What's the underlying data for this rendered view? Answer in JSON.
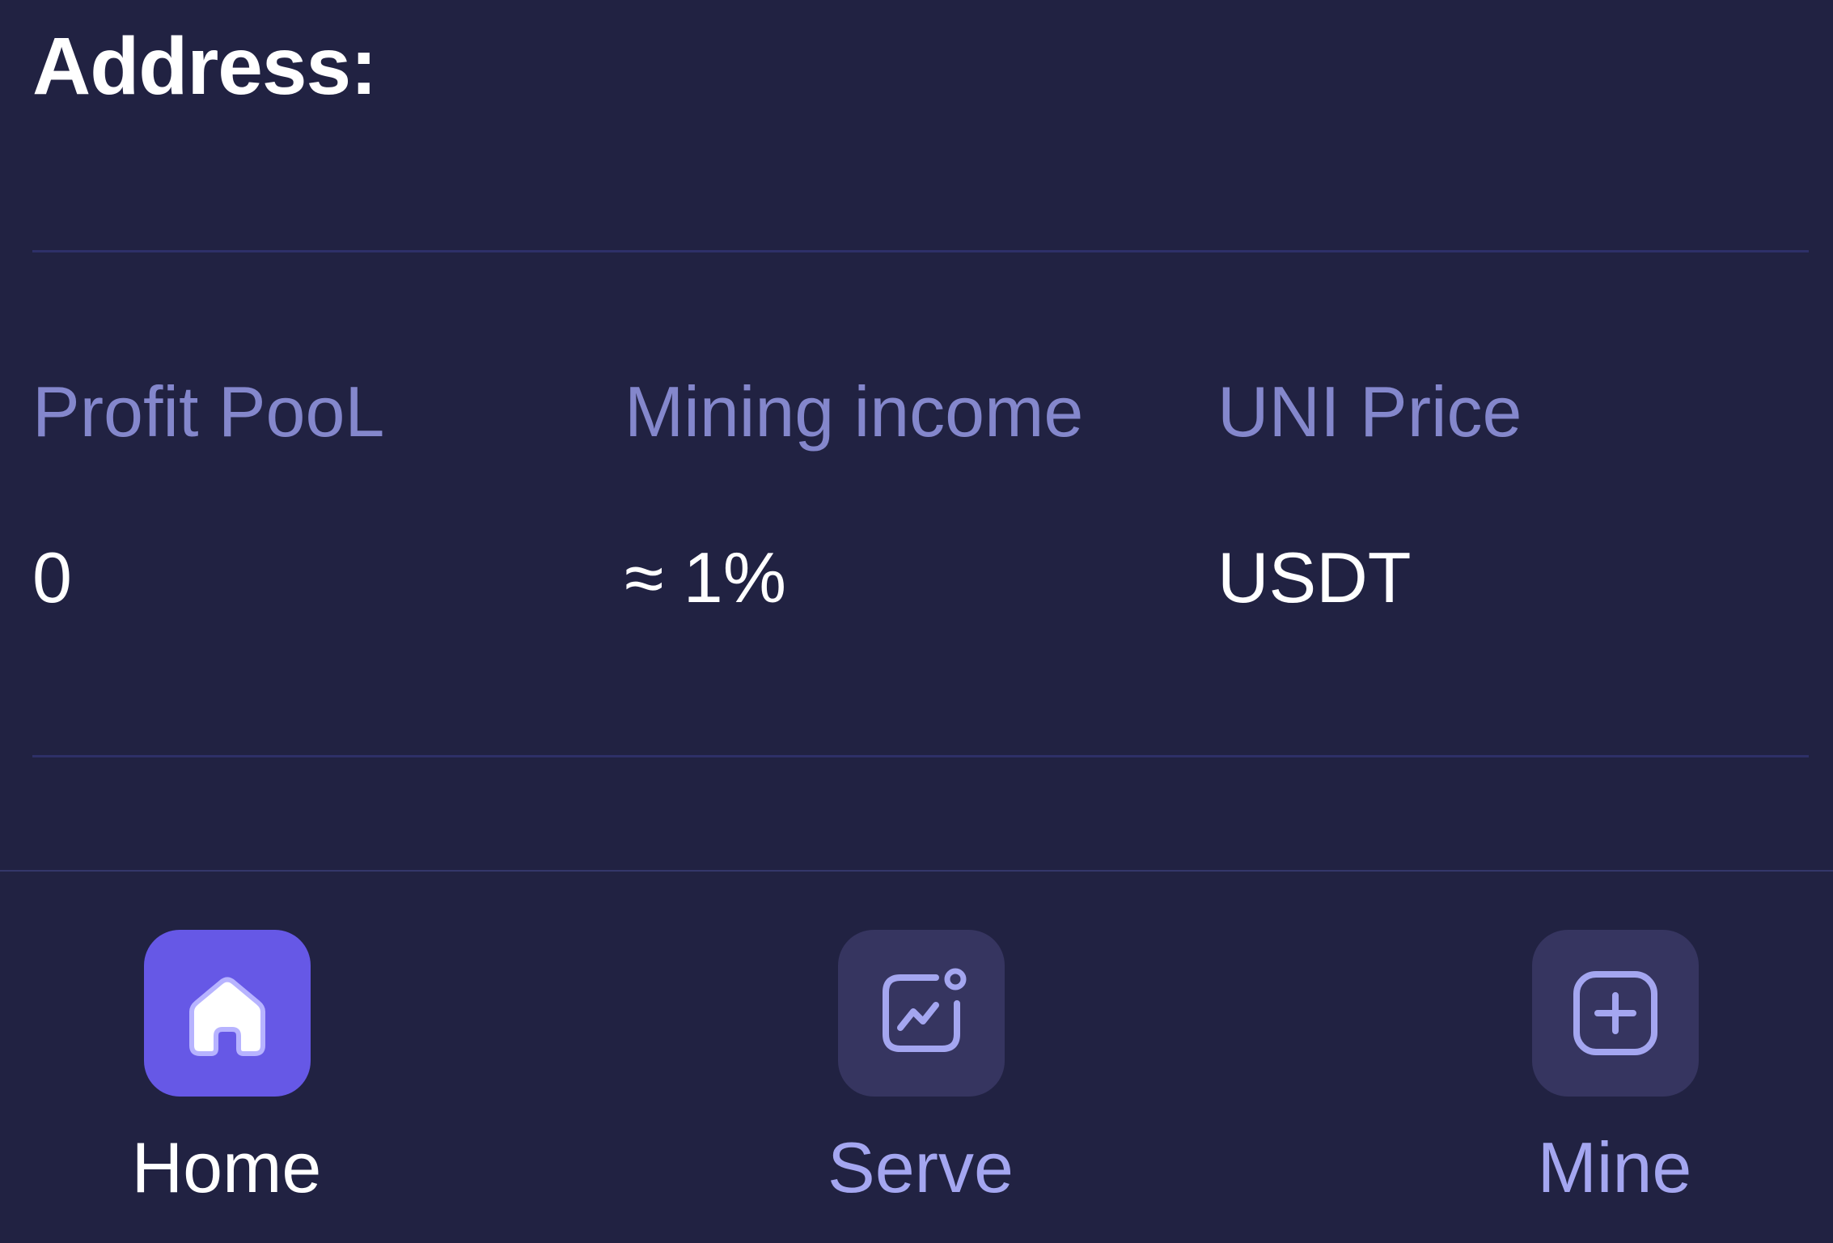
{
  "header": {
    "address_label": "Address:"
  },
  "stats": {
    "profit_pool": {
      "label": "Profit PooL",
      "value": "0"
    },
    "mining_income": {
      "label": "Mining income",
      "value": "≈ 1%"
    },
    "uni_price": {
      "label": "UNI Price",
      "value": "USDT"
    }
  },
  "nav": {
    "active": "home",
    "items": [
      {
        "id": "home",
        "label": "Home",
        "icon": "home-icon"
      },
      {
        "id": "serve",
        "label": "Serve",
        "icon": "chart-icon"
      },
      {
        "id": "mine",
        "label": "Mine",
        "icon": "plus-square-icon"
      }
    ]
  },
  "colors": {
    "background": "#212242",
    "accent": "#6658e6",
    "muted_text": "#8487cc",
    "nav_text": "#a4a6f0",
    "tile": "#363560"
  }
}
